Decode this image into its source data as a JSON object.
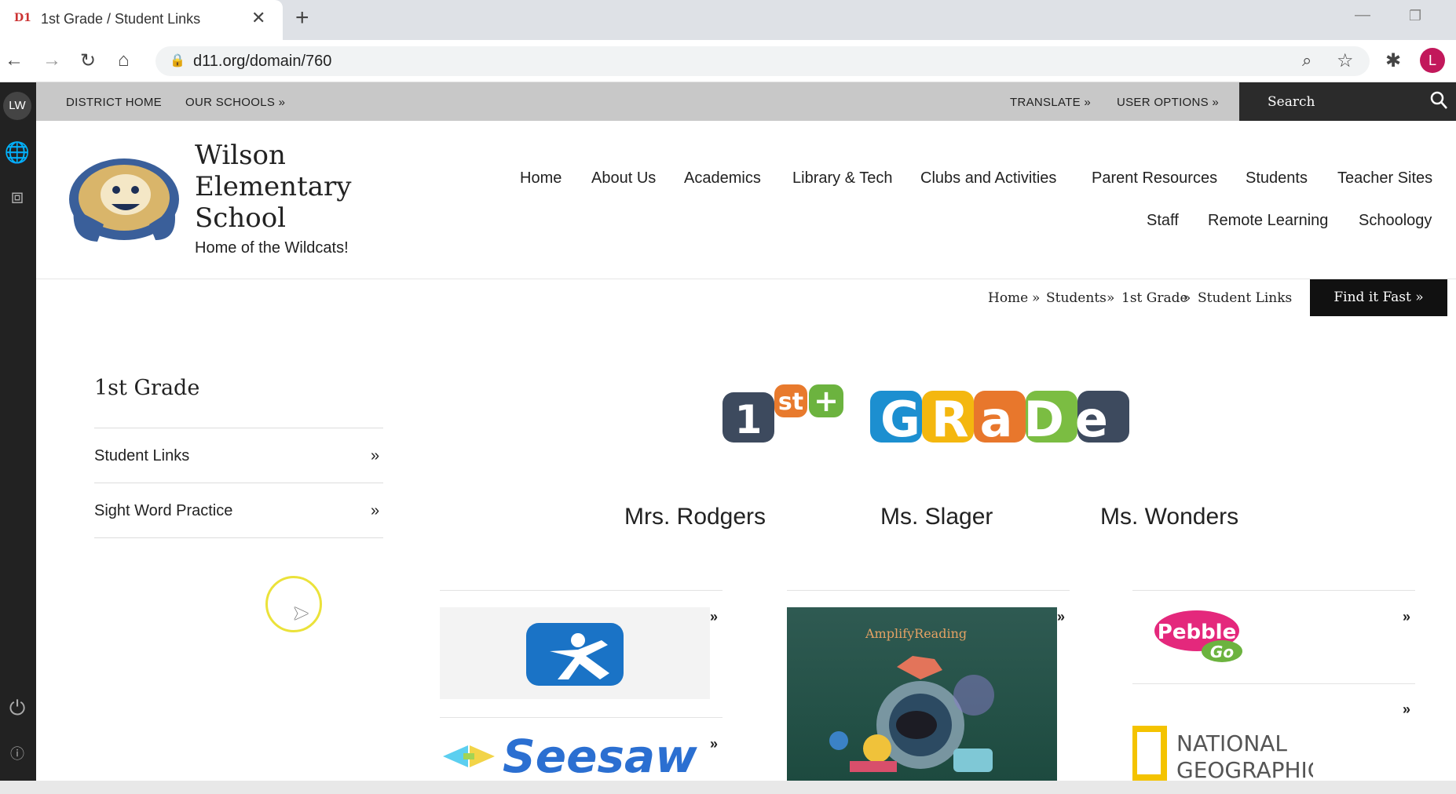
{
  "browser": {
    "tab_title": "1st Grade / Student Links",
    "new_tab": "+",
    "url": "d11.org/domain/760",
    "profile_initial": "L"
  },
  "left_toolbar": {
    "user_initials": "LW"
  },
  "utility_bar": {
    "district_home": "DISTRICT HOME",
    "our_schools": "OUR SCHOOLS »",
    "translate": "TRANSLATE »",
    "user_options": "USER OPTIONS »",
    "search_placeholder": "Search"
  },
  "header": {
    "school_name_line1": "Wilson",
    "school_name_line2": "Elementary",
    "school_name_line3": "School",
    "tagline": "Home of the Wildcats!"
  },
  "main_nav": {
    "row1": [
      "Home",
      "About Us",
      "Academics",
      "Library & Tech",
      "Clubs and Activities",
      "Parent Resources",
      "Students",
      "Teacher Sites"
    ],
    "row2": [
      "Staff",
      "Remote Learning",
      "Schoology"
    ]
  },
  "breadcrumb": {
    "items": [
      "Home",
      "Students",
      "1st Grade",
      "Student Links"
    ],
    "separator": "»"
  },
  "find_it_fast": "Find it Fast »",
  "sidebar": {
    "heading": "1st Grade",
    "items": [
      {
        "label": "Student Links",
        "arrow": "»"
      },
      {
        "label": "Sight Word Practice",
        "arrow": "»"
      }
    ]
  },
  "banner": {
    "part1_number": "1",
    "part1_suffix": "st",
    "word": "GRaDe"
  },
  "teachers": [
    "Mrs. Rodgers",
    "Ms. Slager",
    "Ms. Wonders"
  ],
  "links": {
    "arrow": "»",
    "amplify_brand": "AmplifyReading",
    "seesaw": "Seesaw",
    "pebble": "Pebble",
    "pebble_go": "Go",
    "natgeo_line1": "NATIONAL",
    "natgeo_line2": "GEOGRAPHIC"
  },
  "colors": {
    "utility_bar": "#c8c8c8",
    "search_bg": "#2b2b2b",
    "find_fast_bg": "#111111",
    "left_toolbar": "#222222",
    "profile": "#c2185b",
    "cursor_highlight": "#ebe23a"
  }
}
